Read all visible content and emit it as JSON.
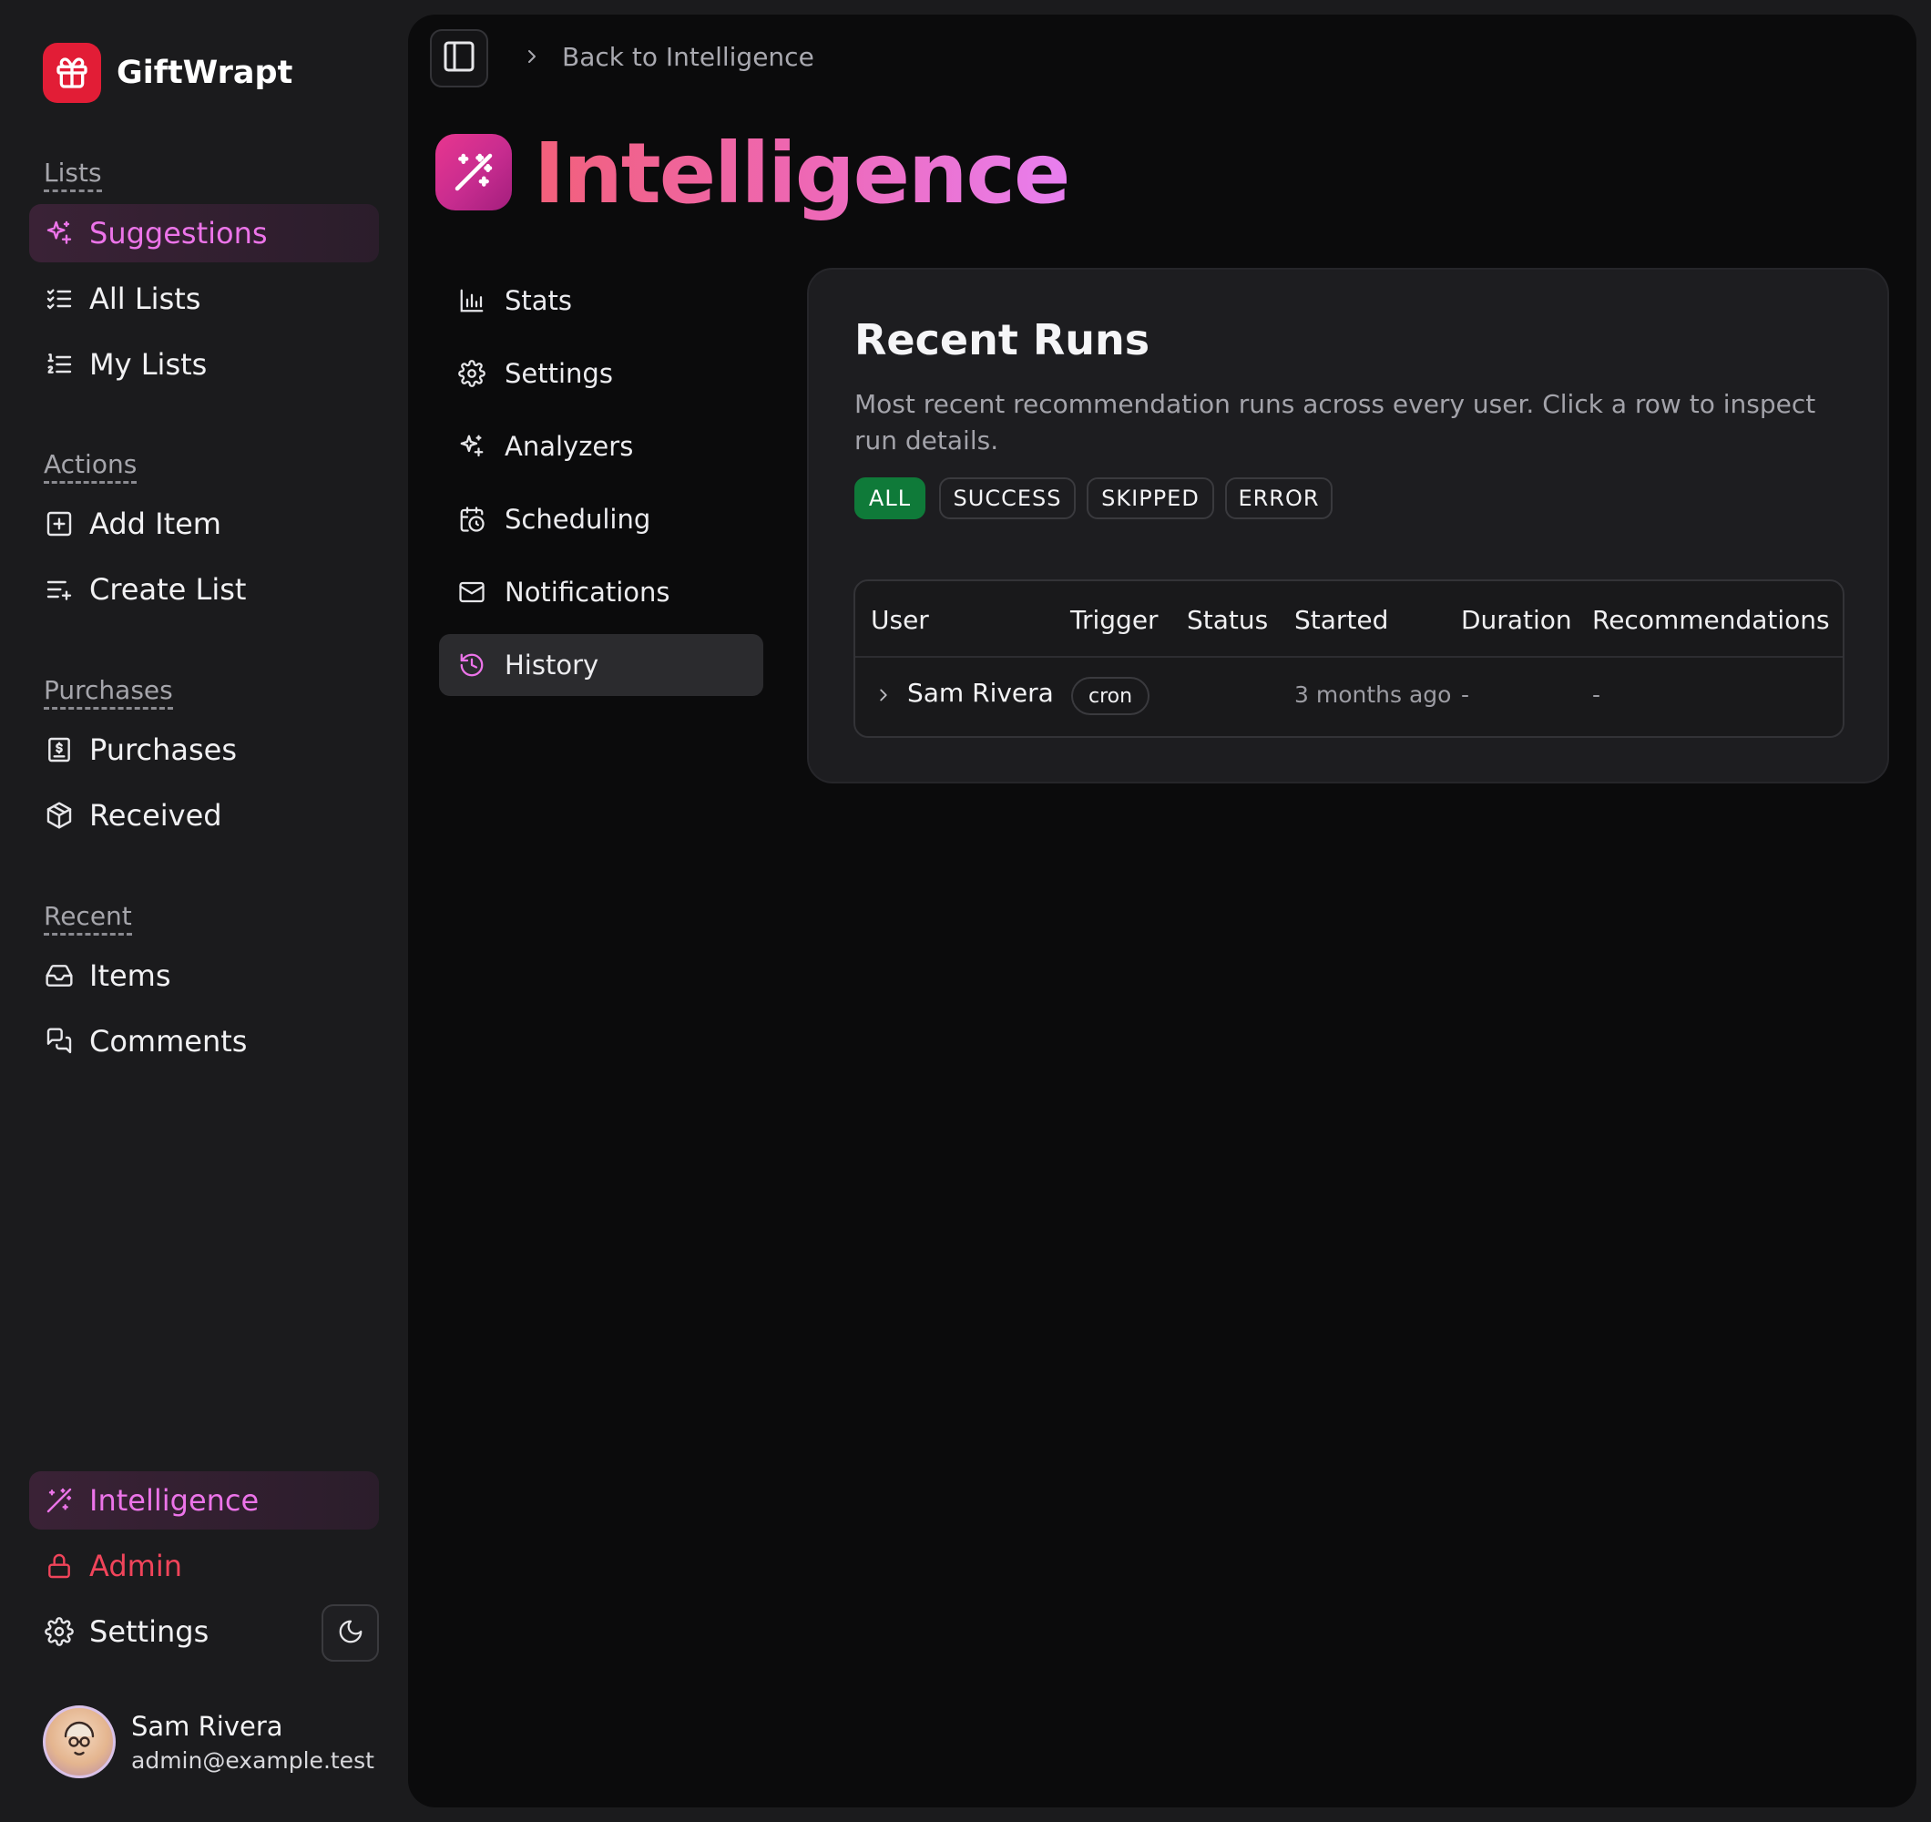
{
  "app": {
    "name": "GiftWrapt"
  },
  "sidebar": {
    "sections": {
      "lists": "Lists",
      "actions": "Actions",
      "purchases": "Purchases",
      "recent": "Recent"
    },
    "items": {
      "suggestions": "Suggestions",
      "all_lists": "All Lists",
      "my_lists": "My Lists",
      "add_item": "Add Item",
      "create_list": "Create List",
      "purchases": "Purchases",
      "received": "Received",
      "items": "Items",
      "comments": "Comments",
      "intelligence": "Intelligence",
      "admin": "Admin",
      "settings": "Settings"
    },
    "user": {
      "name": "Sam Rivera",
      "email": "admin@example.test"
    }
  },
  "header": {
    "breadcrumb": "Back to Intelligence"
  },
  "page": {
    "title": "Intelligence"
  },
  "subnav": {
    "stats": "Stats",
    "settings": "Settings",
    "analyzers": "Analyzers",
    "scheduling": "Scheduling",
    "notifications": "Notifications",
    "history": "History"
  },
  "runs": {
    "title": "Recent Runs",
    "description": "Most recent recommendation runs across every user. Click a row to inspect run details.",
    "filters": [
      "ALL",
      "SUCCESS",
      "SKIPPED",
      "ERROR"
    ],
    "active_filter": "ALL",
    "columns": [
      "User",
      "Trigger",
      "Status",
      "Started",
      "Duration",
      "Recommendations"
    ],
    "rows": [
      {
        "user": "Sam Rivera",
        "trigger": "cron",
        "status": "",
        "started": "3 months ago",
        "duration": "-",
        "recommendations": "-"
      }
    ]
  },
  "colors": {
    "accent_pink": "#ec74e9",
    "brand_red": "#e21d36",
    "active_filter_green": "#0f7a39",
    "admin_red": "#f0445a"
  }
}
